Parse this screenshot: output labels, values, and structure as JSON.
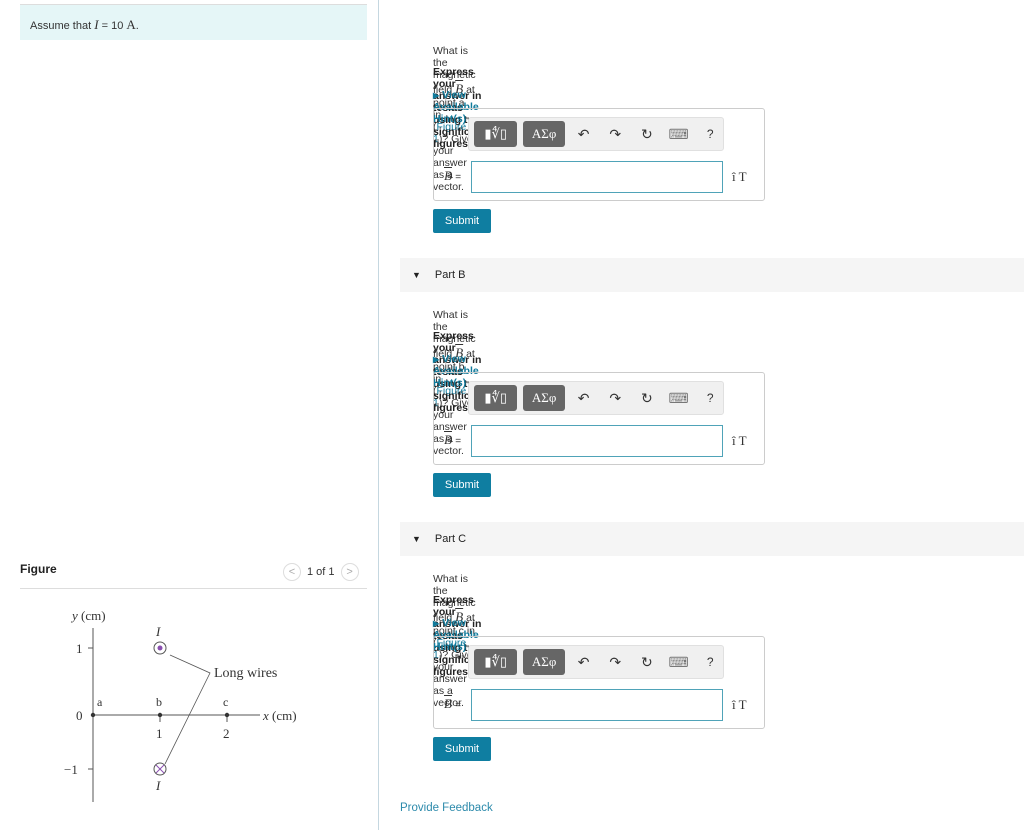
{
  "assume": {
    "prefix": "Assume that",
    "var": "I",
    "rest": "= 10",
    "unit": "A",
    "end": "."
  },
  "figure": {
    "title": "Figure",
    "pager": "1 of 1",
    "ylabel": "y (cm)",
    "xlabel": "x (cm)",
    "wires_label": "Long wires",
    "current_label": "I",
    "points": [
      "a",
      "b",
      "c"
    ],
    "xticks": [
      "1",
      "2"
    ],
    "yticks": [
      "1",
      "0",
      "−1"
    ]
  },
  "parts": [
    {
      "header": "",
      "q_prefix": "What is the magnetic field",
      "q_vec": "B",
      "q_suffix": "at point a in (",
      "fig_link": "Figure 1",
      "q_end": ")? Give your answer as a vector.",
      "express": "Express your answer in teslas using two significant figures.",
      "hint": "View Available Hint(s)",
      "blabel": "B",
      "unit": "î T",
      "submit": "Submit"
    },
    {
      "header": "Part B",
      "q_prefix": "What is the magnetic field",
      "q_vec": "B",
      "q_suffix": "at point b in (",
      "fig_link": "Figure 1",
      "q_end": ")? Give your answer as a vector.",
      "express": "Express your answer in teslas using two significant figures.",
      "hint": "View Available Hint(s)",
      "blabel": "B",
      "unit": "î T",
      "submit": "Submit"
    },
    {
      "header": "Part C",
      "q_prefix": "What is the magnetic field",
      "q_vec": "B",
      "q_suffix": "at point c in (",
      "fig_link": "Figure 1",
      "q_end": ")? Give your answer as a vector.",
      "express": "Express your answer in teslas using two significant figures.",
      "hint": "View Available Hint(s)",
      "blabel": "B",
      "unit": "î T",
      "submit": "Submit"
    }
  ],
  "toolbar": {
    "templates": "▮∜▯",
    "greek": "ΑΣφ",
    "undo": "↶",
    "redo": "↷",
    "reset": "↻",
    "keyboard": "⌨",
    "help": "?"
  },
  "feedback": "Provide Feedback"
}
